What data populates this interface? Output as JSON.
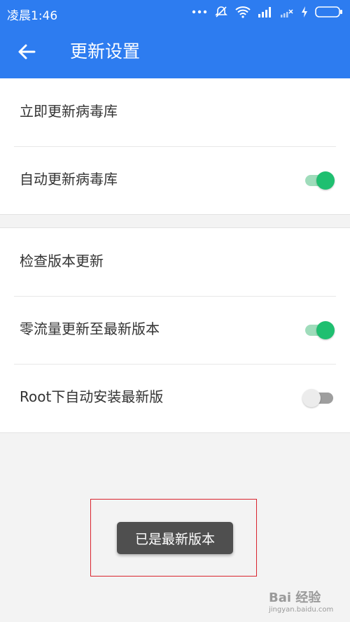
{
  "status_bar": {
    "time": "凌晨1:46",
    "icons": [
      "more-dots-icon",
      "mute-icon",
      "wifi-icon",
      "signal-icon",
      "signal-x-icon",
      "charging-icon",
      "battery-icon"
    ]
  },
  "app_bar": {
    "title": "更新设置",
    "back_icon": "arrow-left-icon"
  },
  "section1": {
    "items": [
      {
        "label": "立即更新病毒库",
        "toggle": null
      },
      {
        "label": "自动更新病毒库",
        "toggle": true
      }
    ]
  },
  "section2": {
    "items": [
      {
        "label": "检查版本更新",
        "toggle": null
      },
      {
        "label": "零流量更新至最新版本",
        "toggle": true
      },
      {
        "label": "Root下自动安装最新版",
        "toggle": false
      }
    ]
  },
  "toast": {
    "message": "已是最新版本"
  },
  "watermark": {
    "logo": "Bai 经验",
    "subtext": "jingyan.baidu.com"
  },
  "colors": {
    "primary": "#2d7cf0",
    "toggle_on": "#1fbf70",
    "highlight_border": "#d9232d"
  }
}
